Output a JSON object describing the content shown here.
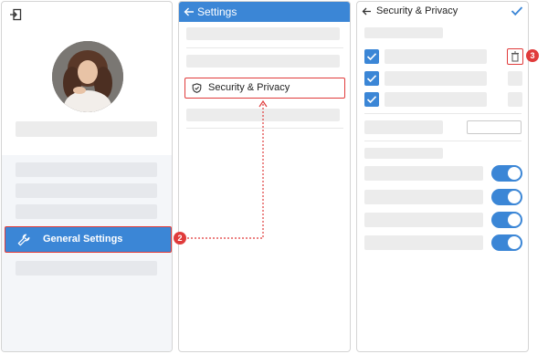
{
  "profile_panel": {
    "menu": {
      "general_settings": "General Settings"
    }
  },
  "settings_panel": {
    "header_title": "Settings",
    "security_item": "Security & Privacy"
  },
  "security_panel": {
    "title": "Security & Privacy",
    "checkboxes_checked": [
      true,
      true,
      true
    ],
    "toggles_on": [
      true,
      true,
      true,
      true
    ]
  },
  "callouts": {
    "step2": "2",
    "step3": "3"
  },
  "colors": {
    "accent": "#3b86d6",
    "highlight": "#e03b3b",
    "placeholder": "#ececec"
  }
}
